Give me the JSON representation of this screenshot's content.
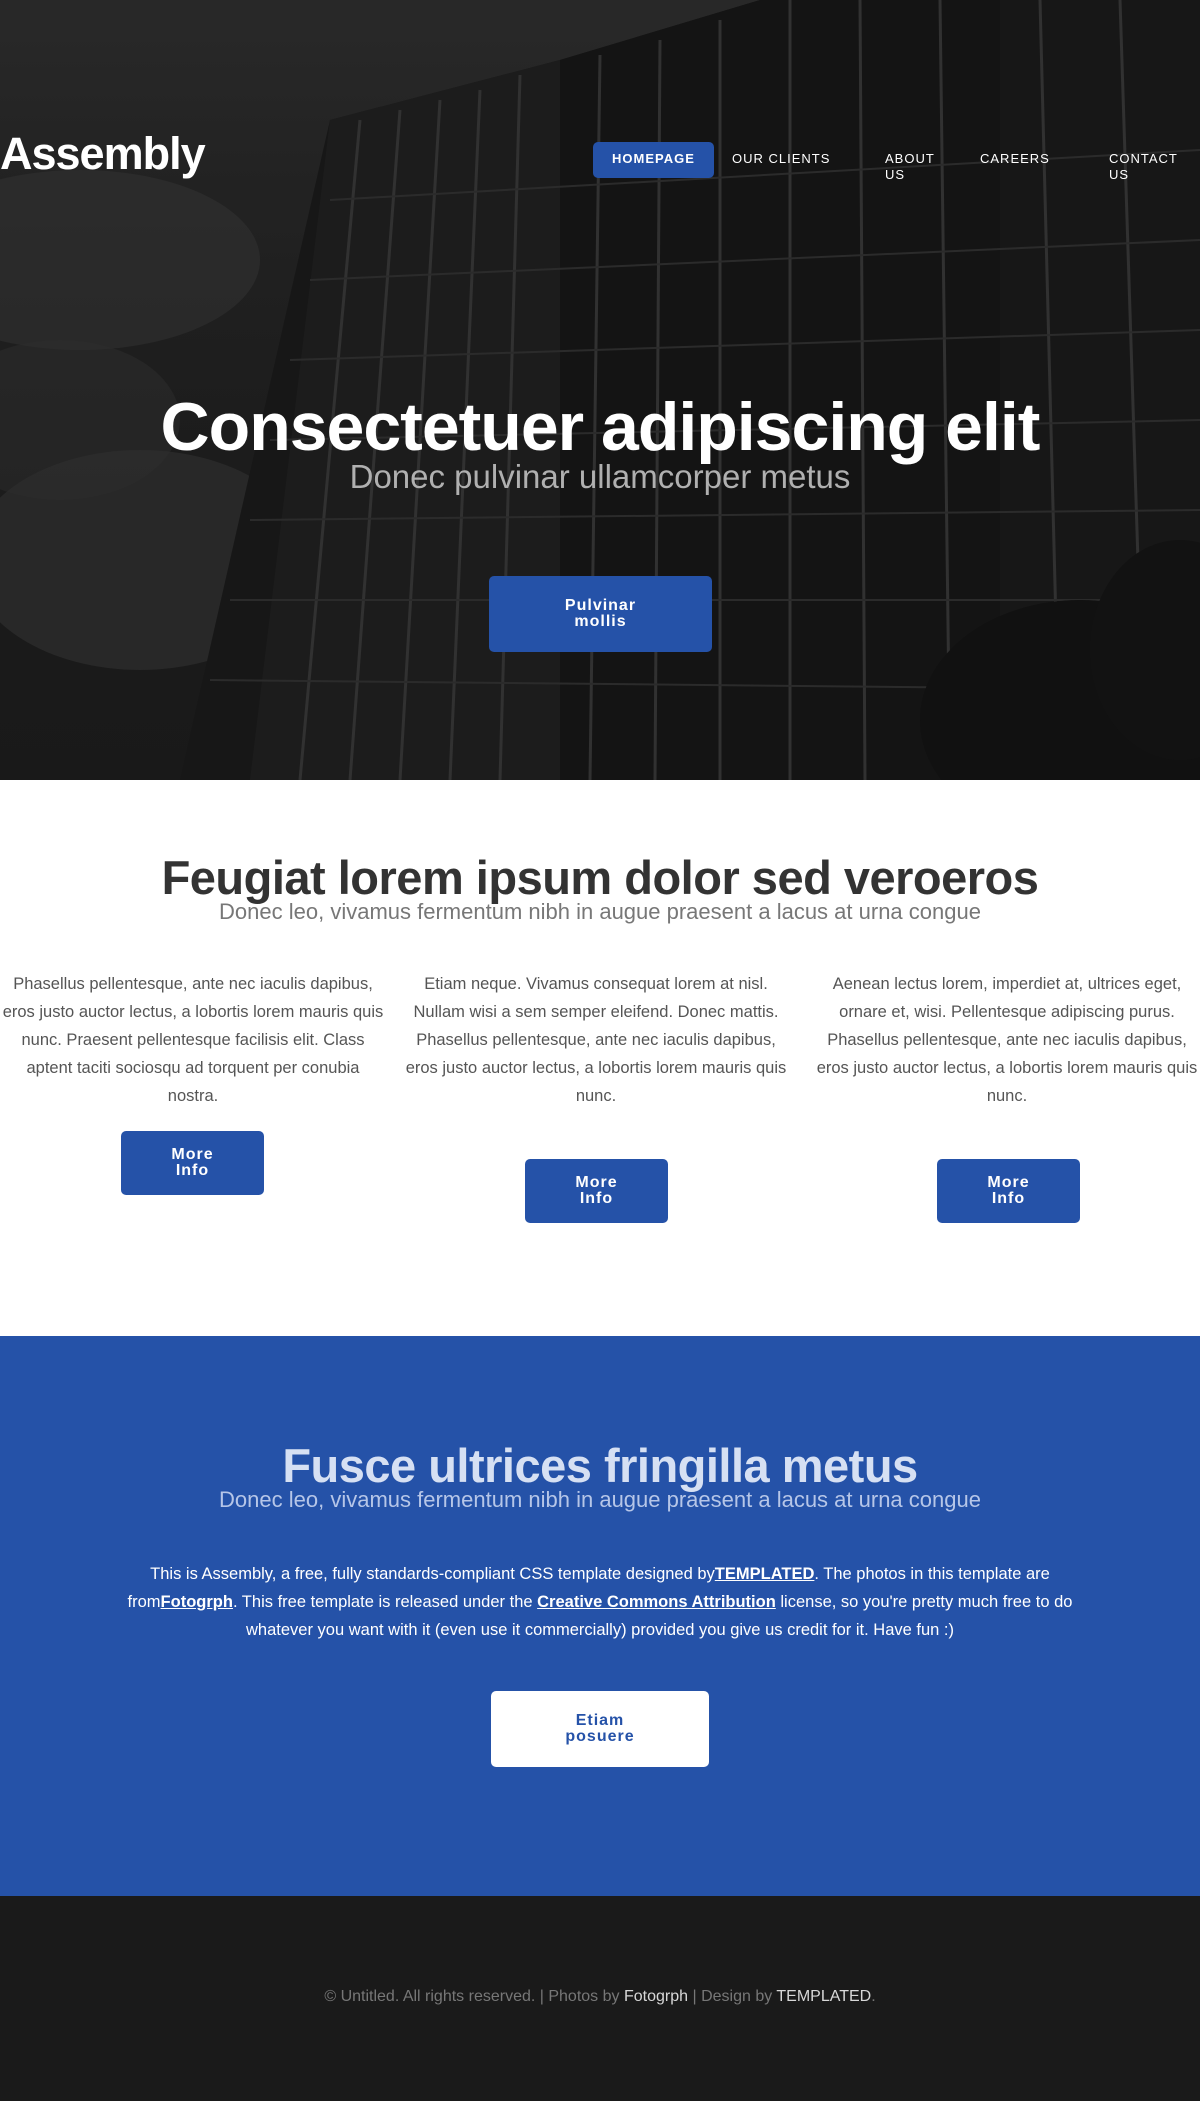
{
  "header": {
    "logo": "Assembly",
    "nav": {
      "homepage": "HOMEPAGE",
      "clients": "OUR CLIENTS",
      "about": "ABOUT US",
      "careers": "CAREERS",
      "contact": "CONTACT US"
    }
  },
  "hero": {
    "title": "Consectetuer adipiscing elit",
    "subtitle": "Donec pulvinar ullamcorper metus",
    "button": "Pulvinar mollis"
  },
  "features": {
    "title": "Feugiat lorem ipsum dolor sed veroeros",
    "subtitle": "Donec leo, vivamus fermentum nibh in augue praesent a lacus at urna congue",
    "columns": [
      {
        "text": "Phasellus pellentesque, ante nec iaculis dapibus, eros justo auctor lectus, a lobortis lorem mauris quis nunc. Praesent pellentesque facilisis elit. Class aptent taciti sociosqu ad torquent per conubia nostra.",
        "button": "More Info"
      },
      {
        "text": "Etiam neque. Vivamus consequat lorem at nisl. Nullam wisi a sem semper eleifend. Donec mattis. Phasellus pellentesque, ante nec iaculis dapibus, eros justo auctor lectus, a lobortis lorem mauris quis nunc.",
        "button": "More Info"
      },
      {
        "text": "Aenean lectus lorem, imperdiet at, ultrices eget, ornare et, wisi. Pellentesque adipiscing purus. Phasellus pellentesque, ante nec iaculis dapibus, eros justo auctor lectus, a lobortis lorem mauris quis nunc.",
        "button": "More Info"
      }
    ]
  },
  "promo": {
    "title": "Fusce ultrices fringilla metus",
    "subtitle": "Donec leo, vivamus fermentum nibh in augue praesent a lacus at urna congue",
    "text_1": "This is Assembly, a free, fully standards-compliant CSS template designed by",
    "link_templated": "TEMPLATED",
    "text_2": ". The photos in this template are from",
    "link_fotogrph": "Fotogrph",
    "text_3": ". This free template is released under the ",
    "link_license": "Creative Commons Attribution",
    "text_4": " license, so you're pretty much free to do whatever you want with it (even use it commercially) provided you give us credit for it. Have fun :)",
    "button": "Etiam posuere"
  },
  "footer": {
    "copyright": "© Untitled. All rights reserved. | Photos by ",
    "photos_link": "Fotogrph",
    "design_text": " | Design by ",
    "design_link": "TEMPLATED",
    "end": "."
  },
  "colors": {
    "accent": "#2552a8",
    "footer_bg": "#1a1a1a",
    "hero_bg": "#262626"
  }
}
